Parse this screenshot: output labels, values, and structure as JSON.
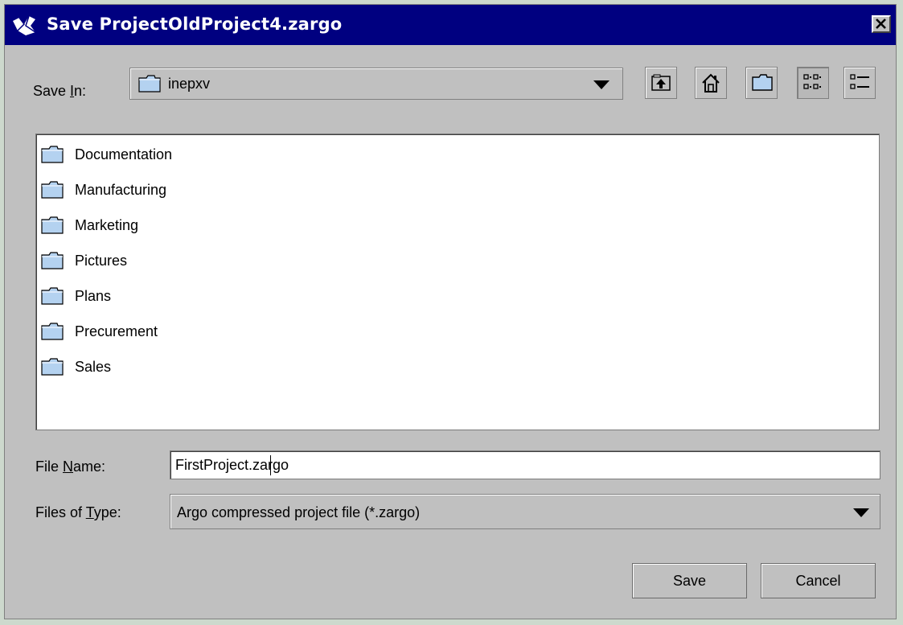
{
  "window": {
    "title": "Save ProjectOldProject4.zargo",
    "close_label": "×"
  },
  "save_in": {
    "label": "Save In:",
    "mnemonic": "I",
    "value": "inepxv"
  },
  "toolbar": {
    "buttons": [
      {
        "name": "up-one-level",
        "icon": "folder-up-icon"
      },
      {
        "name": "home",
        "icon": "home-icon"
      },
      {
        "name": "new-folder",
        "icon": "new-folder-icon"
      },
      {
        "name": "list-view",
        "icon": "list-view-icon",
        "pressed": true
      },
      {
        "name": "details-view",
        "icon": "details-view-icon",
        "pressed": false
      }
    ]
  },
  "files": [
    {
      "name": "Documentation"
    },
    {
      "name": "Manufacturing"
    },
    {
      "name": "Marketing"
    },
    {
      "name": "Pictures"
    },
    {
      "name": "Plans"
    },
    {
      "name": "Precurement"
    },
    {
      "name": "Sales"
    }
  ],
  "file_name": {
    "label": "File Name:",
    "mnemonic": "N",
    "value": "FirstProject.zargo"
  },
  "files_of_type": {
    "label": "Files of Type:",
    "mnemonic": "T",
    "value": "Argo compressed project file (*.zargo)"
  },
  "actions": {
    "save": "Save",
    "cancel": "Cancel"
  },
  "colors": {
    "titlebar": "#000080",
    "dialog": "#c0c0c0",
    "folder": "#b4d2f0"
  }
}
